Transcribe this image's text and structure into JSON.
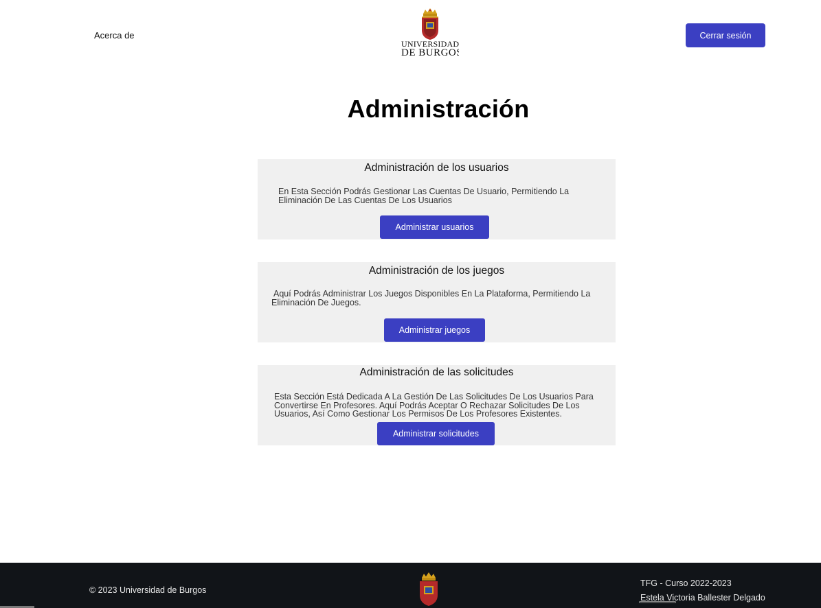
{
  "header": {
    "about_label": "Acerca de",
    "logo_line1": "UNIVERSIDAD",
    "logo_line2": "DE BURGOS",
    "logout_label": "Cerrar sesión"
  },
  "page": {
    "title": "Administración"
  },
  "sections": [
    {
      "title": "Administración de los usuarios",
      "description": "En Esta Sección Podrás Gestionar Las Cuentas De Usuario, Permitiendo La Eliminación De Las Cuentas De Los Usuarios",
      "button_label": "Administrar usuarios"
    },
    {
      "title": "Administración de los juegos",
      "description": "Aquí Podrás Administrar Los Juegos Disponibles En La Plataforma, Permitiendo La Eliminación De Juegos.",
      "button_label": "Administrar juegos"
    },
    {
      "title": "Administración de las solicitudes",
      "description": "Esta Sección Está Dedicada A La Gestión De Las Solicitudes De Los Usuarios Para Convertirse En Profesores. Aquí Podrás Aceptar O Rechazar Solicitudes De Los Usuarios, Así Como Gestionar Los Permisos De Los Profesores Existentes.",
      "button_label": "Administrar solicitudes"
    }
  ],
  "footer": {
    "copyright": "© 2023 Universidad de Burgos",
    "course": "TFG - Curso 2022-2023",
    "author": "Estela Victoria Ballester Delgado"
  },
  "colors": {
    "accent": "#3b3fc2",
    "card_bg": "#f0f0f0",
    "footer_bg": "#111418",
    "crest_red": "#b52a2a",
    "crest_gold": "#d6a21e"
  }
}
